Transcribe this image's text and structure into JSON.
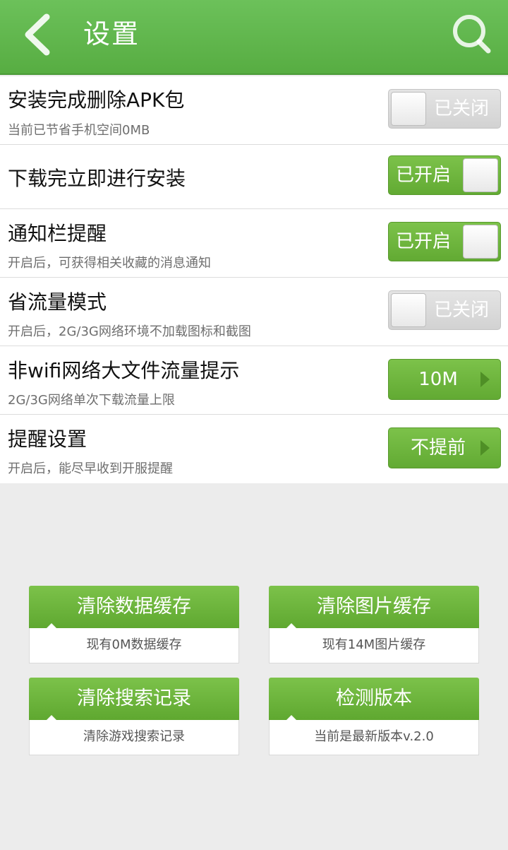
{
  "header": {
    "title": "设置",
    "back_icon": "chevron-left-icon",
    "search_icon": "search-icon"
  },
  "colors": {
    "accent_green": "#62aa33",
    "header_green": "#5fb54b",
    "toggle_off": "#d8d8d8"
  },
  "settings": [
    {
      "title": "安装完成删除APK包",
      "desc": "当前已节省手机空间0MB",
      "control": "toggle",
      "state": "off",
      "label": "已关闭"
    },
    {
      "title": "下载完立即进行安装",
      "desc": "",
      "control": "toggle",
      "state": "on",
      "label": "已开启"
    },
    {
      "title": "通知栏提醒",
      "desc": "开启后，可获得相关收藏的消息通知",
      "control": "toggle",
      "state": "on",
      "label": "已开启"
    },
    {
      "title": "省流量模式",
      "desc": "开启后，2G/3G网络环境不加载图标和截图",
      "control": "toggle",
      "state": "off",
      "label": "已关闭"
    },
    {
      "title": "非wifi网络大文件流量提示",
      "desc": "2G/3G网络单次下载流量上限",
      "control": "select",
      "label": "10M"
    },
    {
      "title": "提醒设置",
      "desc": "开启后，能尽早收到开服提醒",
      "control": "select",
      "label": "不提前"
    }
  ],
  "actions": [
    {
      "label": "清除数据缓存",
      "info": "现有0M数据缓存"
    },
    {
      "label": "清除图片缓存",
      "info": "现有14M图片缓存"
    },
    {
      "label": "清除搜索记录",
      "info": "清除游戏搜索记录"
    },
    {
      "label": "检测版本",
      "info": "当前是最新版本v.2.0"
    }
  ]
}
